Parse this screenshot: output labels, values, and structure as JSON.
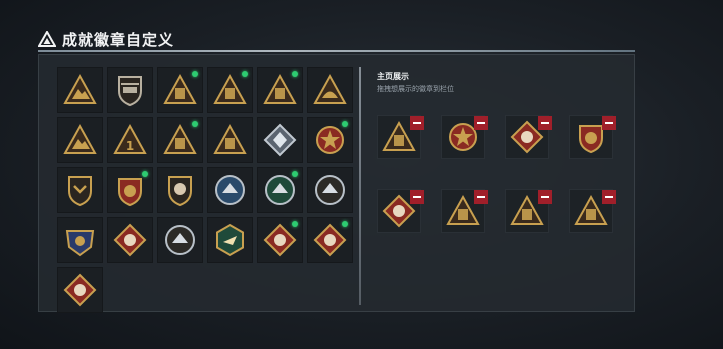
{
  "header": {
    "title": "成就徽章自定义",
    "icon": "triangle-emblem-icon"
  },
  "showcase": {
    "title": "主页展示",
    "hint": "拖拽想展示的徽章到栏位"
  },
  "colors": {
    "accent_new": "#2ecc71",
    "remove": "#a01f2a",
    "gold": "#c8a050",
    "badge_red": "#8a2a22"
  },
  "badges": [
    {
      "icon": "mountain-triangle-badge-icon",
      "new": false
    },
    {
      "icon": "helicopter-shield-badge-icon",
      "new": false
    },
    {
      "icon": "backpack-triangle-badge-icon",
      "new": true
    },
    {
      "icon": "vest-triangle-badge-icon",
      "new": true
    },
    {
      "icon": "pack-triangle-badge-icon",
      "new": true
    },
    {
      "icon": "helmet-triangle-badge-icon",
      "new": false
    },
    {
      "icon": "wolf-triangle-badge-icon",
      "new": false
    },
    {
      "icon": "number-one-triangle-badge-icon",
      "new": false
    },
    {
      "icon": "ammo-triangle-badge-icon",
      "new": true
    },
    {
      "icon": "armor-triangle-badge-icon",
      "new": false
    },
    {
      "icon": "crystal-diamond-badge-icon",
      "new": false
    },
    {
      "icon": "star-cross-medal-badge-icon",
      "new": true
    },
    {
      "icon": "chevron-shield-badge-icon",
      "new": false
    },
    {
      "icon": "eagle-star-shield-badge-icon",
      "new": true
    },
    {
      "icon": "lion-shield-badge-icon",
      "new": false
    },
    {
      "icon": "blue-eagle-round-badge-icon",
      "new": false
    },
    {
      "icon": "green-eagle-round-badge-icon",
      "new": true
    },
    {
      "icon": "dagger-round-badge-icon",
      "new": false
    },
    {
      "icon": "gold-eagle-crest-badge-icon",
      "new": false
    },
    {
      "icon": "beast-diamond-badge-icon",
      "new": false
    },
    {
      "icon": "wolf-round-badge-icon",
      "new": false
    },
    {
      "icon": "plane-hexagon-badge-icon",
      "new": false
    },
    {
      "icon": "dragon-diamond-badge-icon",
      "new": true
    },
    {
      "icon": "dragon-diamond-badge-icon",
      "new": true
    },
    {
      "icon": "runner-diamond-badge-icon",
      "new": false
    }
  ],
  "slots": [
    {
      "icon": "ammo-triangle-badge-icon"
    },
    {
      "icon": "star-cross-medal-badge-icon"
    },
    {
      "icon": "dragon-diamond-badge-icon"
    },
    {
      "icon": "eagle-star-shield-badge-icon"
    },
    {
      "icon": "dragon-diamond-badge-icon"
    },
    {
      "icon": "backpack-triangle-badge-icon"
    },
    {
      "icon": "vest-triangle-badge-icon"
    },
    {
      "icon": "pack-triangle-badge-icon"
    }
  ]
}
